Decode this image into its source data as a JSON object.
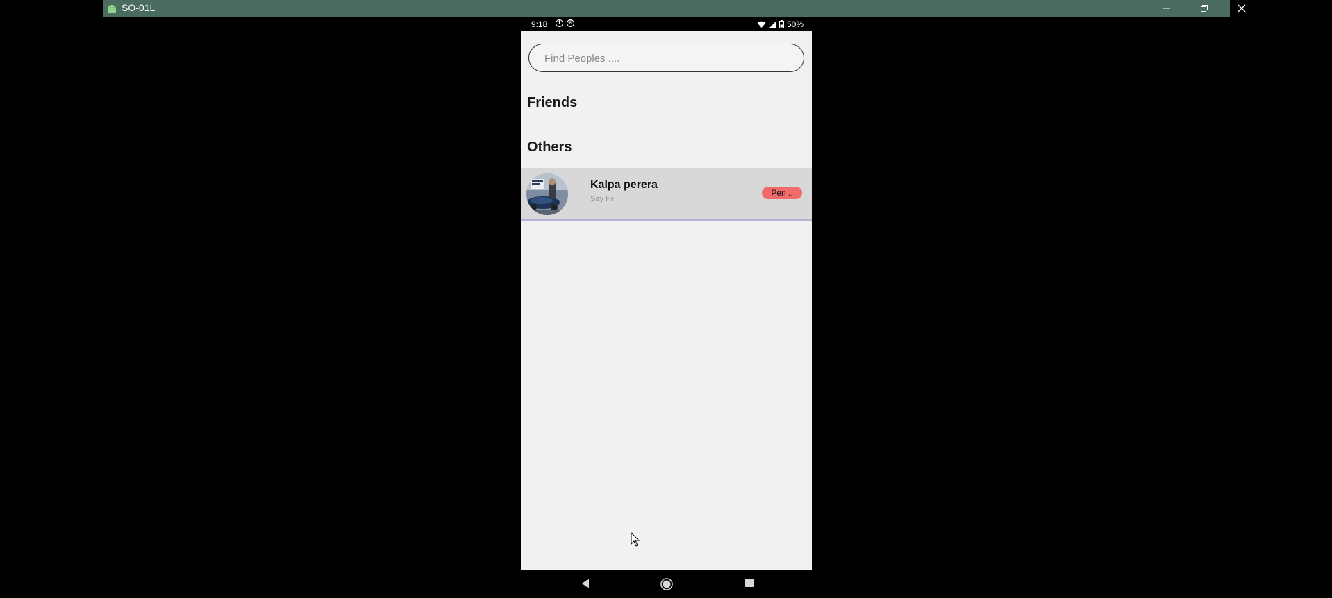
{
  "window": {
    "title": "SO-01L",
    "bar_color": "#4a6b5f",
    "icons": [
      "android-icon",
      "minimize-icon",
      "restore-icon",
      "close-icon"
    ]
  },
  "status_bar": {
    "time": "9:18",
    "battery": "50%",
    "icons": [
      "facebook-notification-icon",
      "app-notification-icon",
      "wifi-icon",
      "signal-icon",
      "battery-icon"
    ]
  },
  "search": {
    "placeholder": "Find Peoples ...."
  },
  "sections": {
    "friends_title": "Friends",
    "others_title": "Others"
  },
  "others": [
    {
      "name": "Kalpa perera",
      "subtitle": "Say Hi",
      "status_label": "Pen ..",
      "status_color": "#f26b6b"
    }
  ],
  "nav_bar": {
    "icons": [
      "back-icon",
      "home-icon",
      "recents-icon"
    ]
  }
}
